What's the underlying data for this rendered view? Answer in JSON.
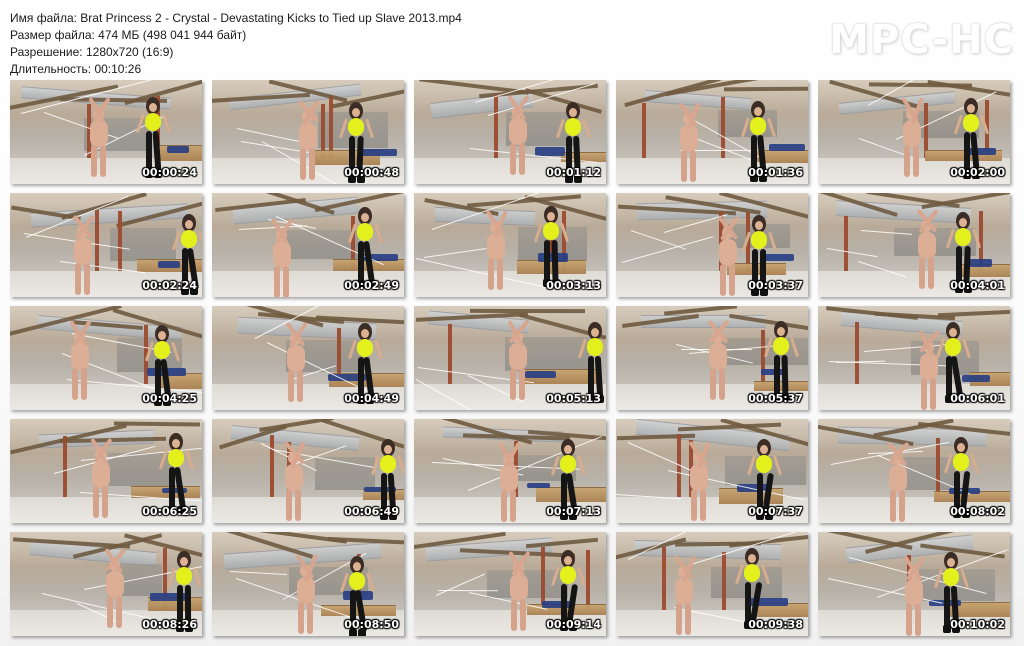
{
  "header": {
    "file_name": "Имя файла: Brat Princess 2 - Crystal - Devastating Kicks to Tied up Slave 2013.mp4",
    "file_size": "Размер файла: 474 МБ (498 041 944 байт)",
    "resolution": "Разрешение: 1280x720 (16:9)",
    "duration": "Длительность: 00:10:26"
  },
  "brand": "MPC-HC",
  "thumbnails": [
    {
      "time": "00:00:24"
    },
    {
      "time": "00:00:48"
    },
    {
      "time": "00:01:12"
    },
    {
      "time": "00:01:36"
    },
    {
      "time": "00:02:00"
    },
    {
      "time": "00:02:24"
    },
    {
      "time": "00:02:49"
    },
    {
      "time": "00:03:13"
    },
    {
      "time": "00:03:37"
    },
    {
      "time": "00:04:01"
    },
    {
      "time": "00:04:25"
    },
    {
      "time": "00:04:49"
    },
    {
      "time": "00:05:13"
    },
    {
      "time": "00:05:37"
    },
    {
      "time": "00:06:01"
    },
    {
      "time": "00:06:25"
    },
    {
      "time": "00:06:49"
    },
    {
      "time": "00:07:13"
    },
    {
      "time": "00:07:37"
    },
    {
      "time": "00:08:02"
    },
    {
      "time": "00:08:26"
    },
    {
      "time": "00:08:50"
    },
    {
      "time": "00:09:14"
    },
    {
      "time": "00:09:38"
    },
    {
      "time": "00:10:02"
    }
  ]
}
